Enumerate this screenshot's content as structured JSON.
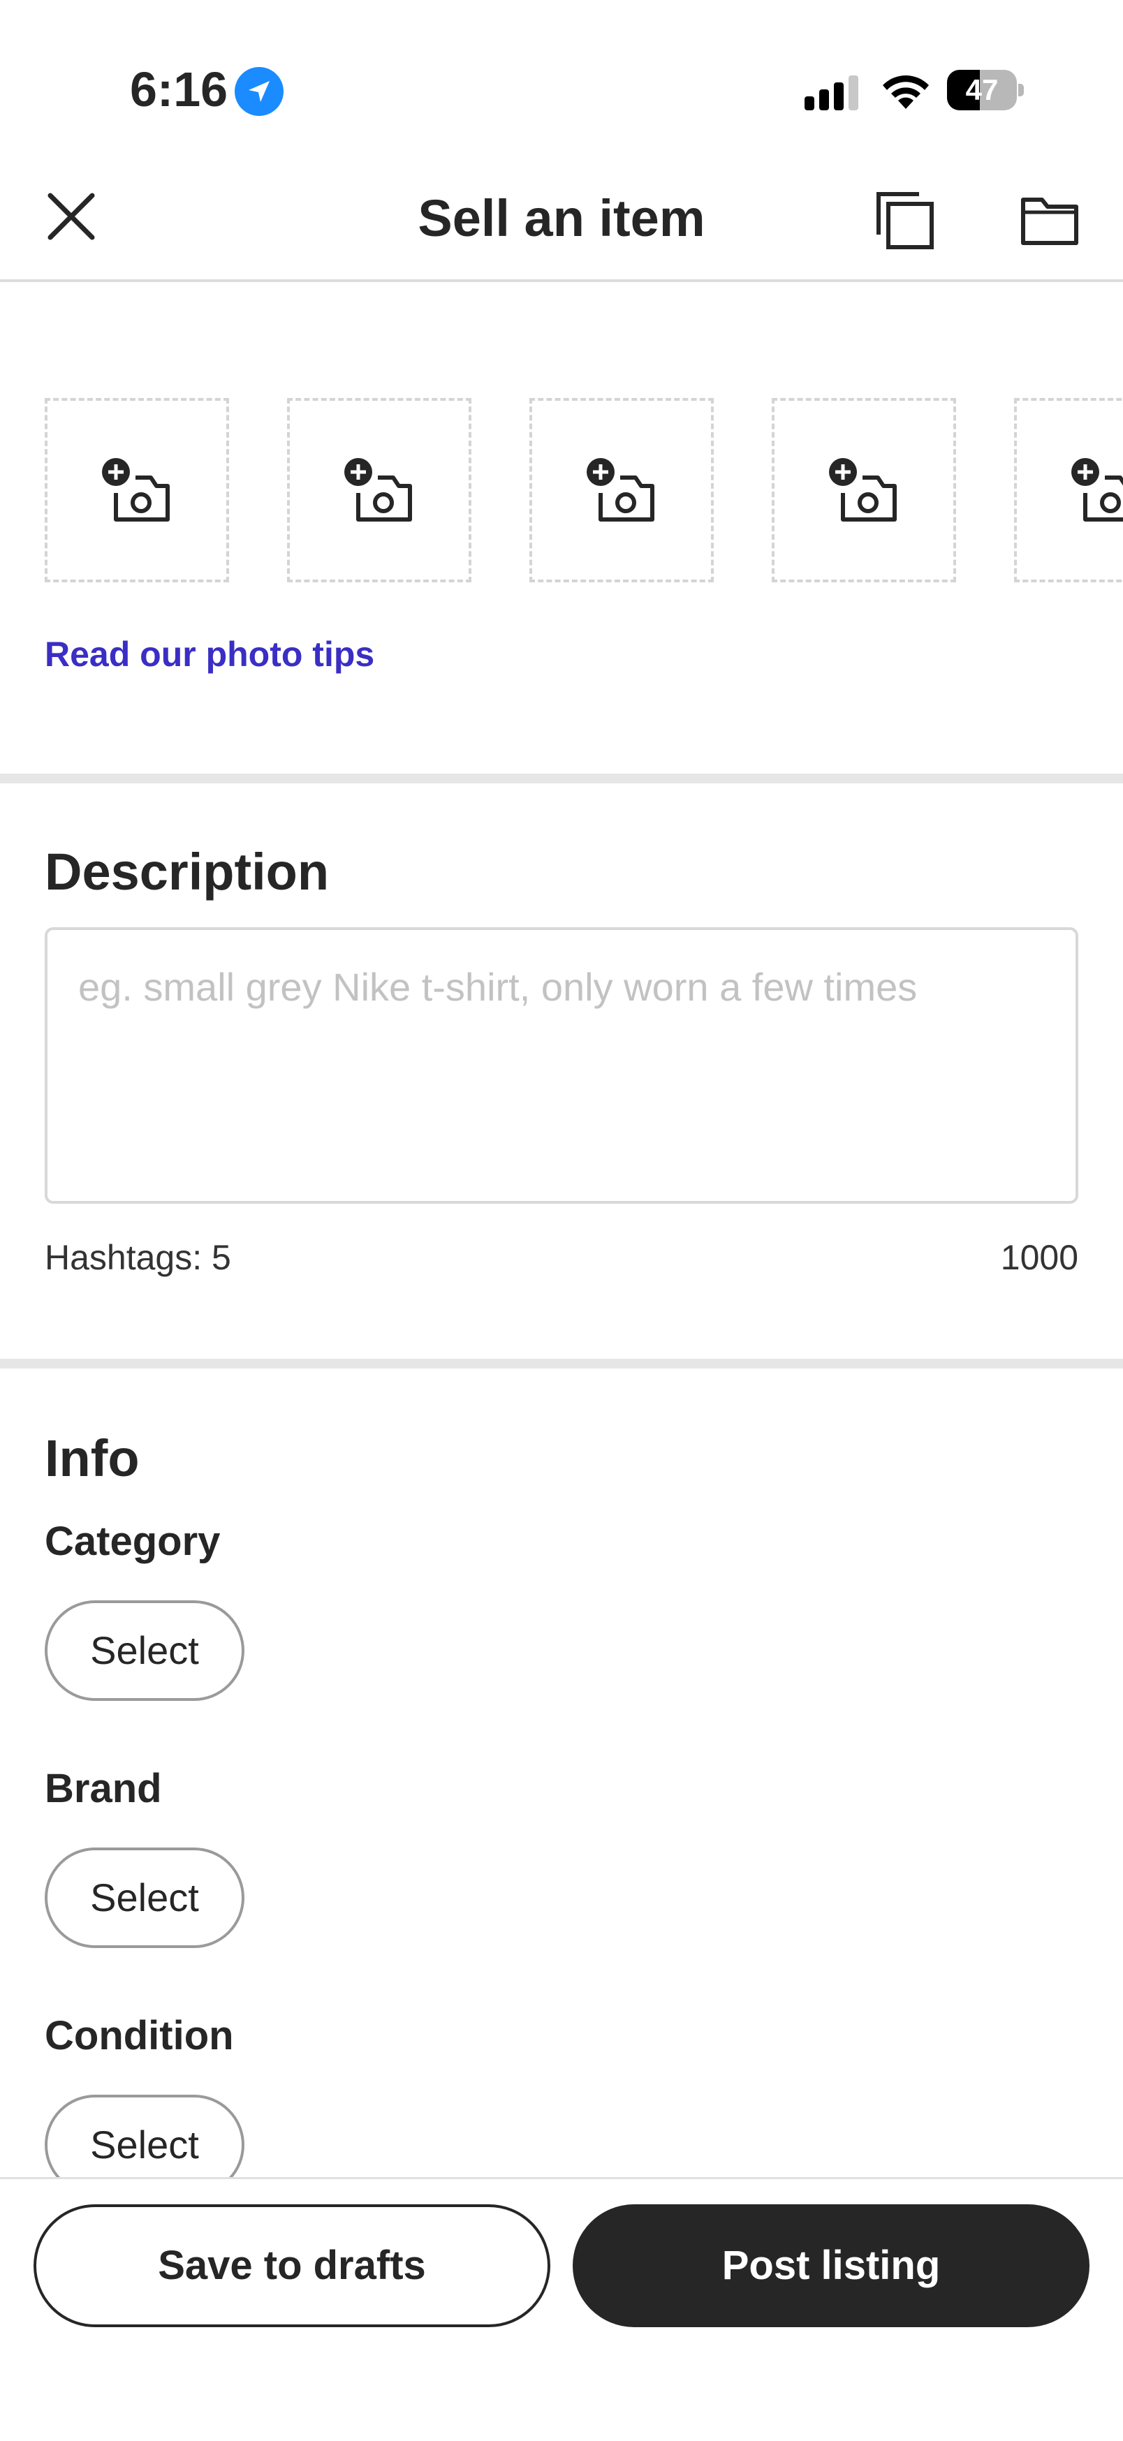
{
  "status_bar": {
    "time": "6:16",
    "battery": "47",
    "battery_level": 0.47,
    "icons": [
      "location-arrow-icon",
      "cellular-signal-icon",
      "wifi-icon",
      "battery-icon"
    ]
  },
  "header": {
    "title": "Sell an item",
    "close_icon": "close-icon",
    "copy_icon": "copy-icon",
    "folder_icon": "folder-icon"
  },
  "photos": {
    "slot_icon": "add-photo-camera-icon",
    "slot_count": 5,
    "tips_link": "Read our photo tips"
  },
  "description": {
    "title": "Description",
    "placeholder": "eg. small grey Nike t-shirt, only worn a few times",
    "hashtags": "Hashtags: 5",
    "char_count": "1000"
  },
  "info": {
    "title": "Info",
    "fields": [
      {
        "label": "Category",
        "value": "Select"
      },
      {
        "label": "Brand",
        "value": "Select"
      },
      {
        "label": "Condition",
        "value": "Select"
      }
    ]
  },
  "actions": {
    "save": "Save to drafts",
    "post": "Post listing"
  },
  "colors": {
    "link": "#3a2ec4",
    "primary_button": "#262626",
    "location_icon": "#1a8cff"
  }
}
